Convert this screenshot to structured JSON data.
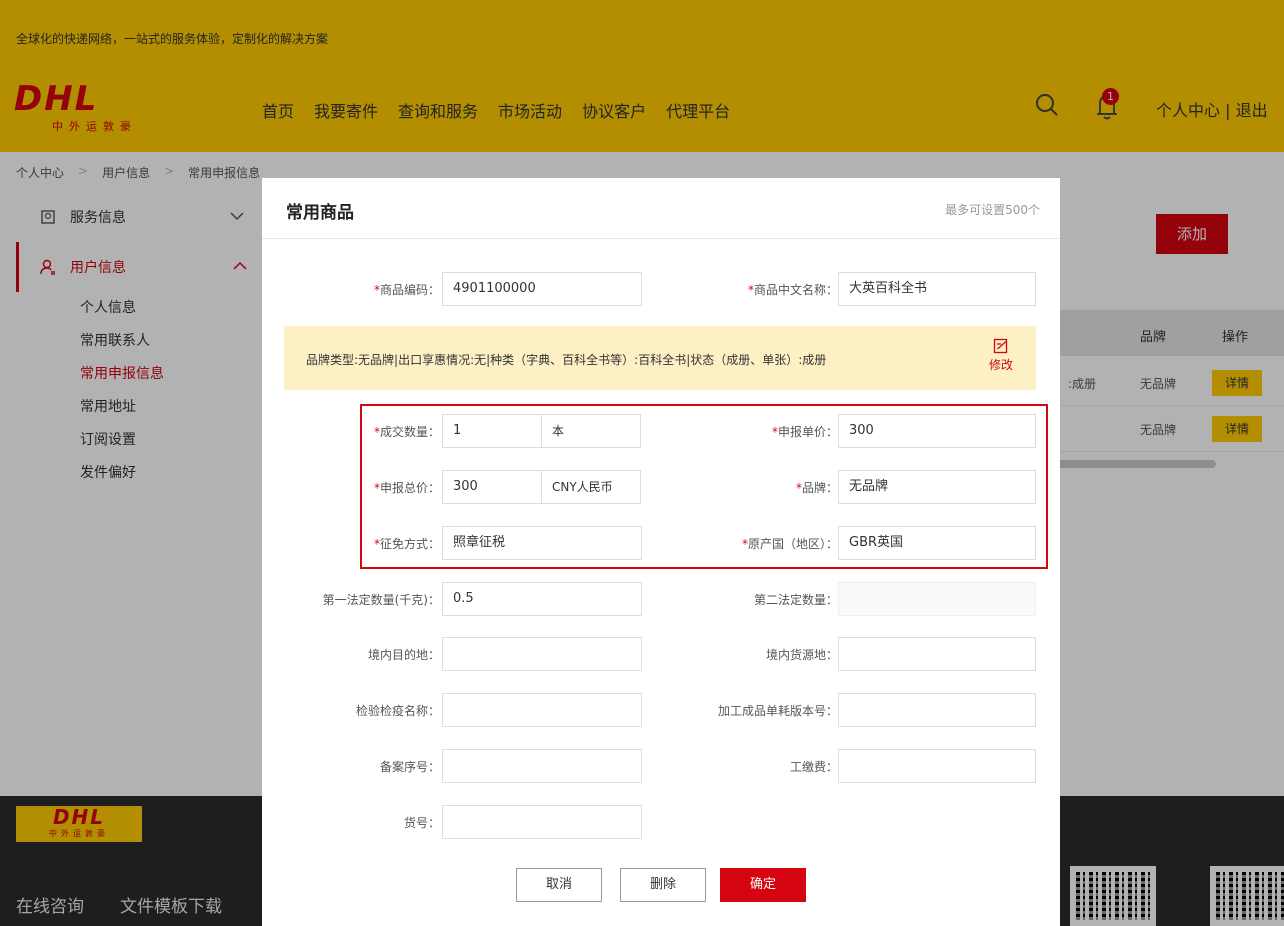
{
  "header": {
    "slogan": "全球化的快递网络，一站式的服务体验，定制化的解决方案",
    "logo_text": "DHL",
    "logo_subtitle": "中外运敦豪",
    "nav": [
      "首页",
      "我要寄件",
      "查询和服务",
      "市场活动",
      "协议客户",
      "代理平台"
    ],
    "notification_count": "1",
    "user_links": "个人中心 | 退出"
  },
  "breadcrumb": [
    "个人中心",
    "用户信息",
    "常用申报信息"
  ],
  "sidebar": {
    "groups": [
      {
        "label": "服务信息"
      },
      {
        "label": "用户信息"
      }
    ],
    "items": [
      "个人信息",
      "常用联系人",
      "常用申报信息",
      "常用地址",
      "订阅设置",
      "发件偏好"
    ]
  },
  "main": {
    "add_button": "添加",
    "columns": [
      "品牌",
      "操作"
    ],
    "rows": [
      {
        "fragment": "）:成册",
        "brand": "无品牌",
        "action": "详情"
      },
      {
        "fragment": "",
        "brand": "无品牌",
        "action": "详情"
      }
    ]
  },
  "footer": {
    "logo_text": "DHL",
    "logo_subtitle": "中外运敦豪",
    "links": [
      "在线咨询",
      "文件模板下载"
    ]
  },
  "modal": {
    "title": "常用商品",
    "hint": "最多可设置500个",
    "commodity_code": {
      "label": "商品编码：",
      "value": "4901100000"
    },
    "chinese_name": {
      "label": "商品中文名称：",
      "value": "大英百科全书"
    },
    "info_text": "品牌类型:无品牌|出口享惠情况:无|种类（字典、百科全书等）:百科全书|状态（成册、单张）:成册",
    "edit_label": "修改",
    "quantity": {
      "label": "成交数量：",
      "value": "1",
      "unit": "本"
    },
    "unit_price": {
      "label": "申报单价：",
      "value": "300"
    },
    "total_price": {
      "label": "申报总价：",
      "value": "300",
      "unit": "CNY人民币"
    },
    "brand": {
      "label": "品牌：",
      "value": "无品牌"
    },
    "tax_method": {
      "label": "征免方式：",
      "value": "照章征税"
    },
    "origin_country": {
      "label": "原产国（地区）：",
      "value": "GBR英国"
    },
    "first_legal_qty": {
      "label": "第一法定数量(千克)：",
      "value": "0.5"
    },
    "second_legal_qty": {
      "label": "第二法定数量：",
      "value": ""
    },
    "domestic_destination": {
      "label": "境内目的地：",
      "value": ""
    },
    "domestic_source": {
      "label": "境内货源地：",
      "value": ""
    },
    "inspection_name": {
      "label": "检验检疫名称：",
      "value": ""
    },
    "processing_version": {
      "label": "加工成品单耗版本号：",
      "value": ""
    },
    "record_number": {
      "label": "备案序号：",
      "value": ""
    },
    "labor_fee": {
      "label": "工缴费：",
      "value": ""
    },
    "item_number": {
      "label": "货号：",
      "value": ""
    },
    "buttons": {
      "cancel": "取消",
      "delete": "删除",
      "confirm": "确定"
    }
  }
}
